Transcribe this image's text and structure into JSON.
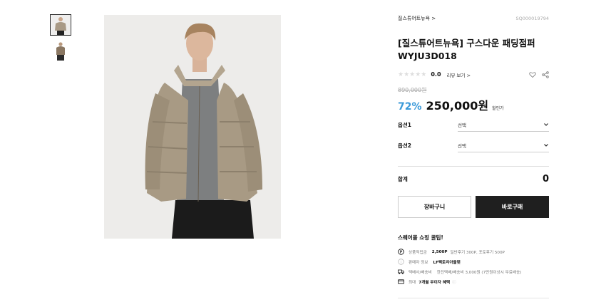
{
  "thumbnails": [
    {
      "name": "thumbnail-1",
      "active": true
    },
    {
      "name": "thumbnail-2",
      "active": false
    }
  ],
  "product": {
    "brand_link": "질스튜어트뉴욕 >",
    "code": "SQ000019794",
    "title_line1": "[질스튜어트뉴욕] 구스다운 패딩점퍼",
    "title_line2": "WYJU3D018",
    "stars": "★★★★★",
    "score": "0.0",
    "review_link": "리뷰 보기 >",
    "original_price": "890,000원",
    "discount": "72%",
    "price": "250,000원",
    "price_tag": "할인가"
  },
  "options": [
    {
      "label": "옵션1",
      "value": "선택"
    },
    {
      "label": "옵션2",
      "value": "선택"
    }
  ],
  "total": {
    "label": "합계",
    "value": "0"
  },
  "buttons": {
    "cart": "장바구니",
    "buy": "바로구매"
  },
  "tips": {
    "title": "스퀘어몰 쇼핑 꿀팁!",
    "rows": [
      {
        "icon": "point-icon",
        "label": "상품적립금",
        "strong": "2,500P",
        "sub": "일반후기 300P, 포토후기 500P"
      },
      {
        "icon": "info-icon",
        "label": "판매자 정보",
        "strong": "LF팩토리아울렛",
        "sub": ""
      },
      {
        "icon": "truck-icon",
        "label": "택배사/배송비",
        "strong": "",
        "sub": "한진택배/배송비 3,000원 (7만원이상시 무료배송)"
      },
      {
        "icon": "card-icon",
        "label": "최대",
        "strong": "7개월 무이자 혜택",
        "sub": ""
      }
    ]
  },
  "colors": {
    "accent": "#3b9ad9",
    "buy_button": "#1f1f1f"
  }
}
